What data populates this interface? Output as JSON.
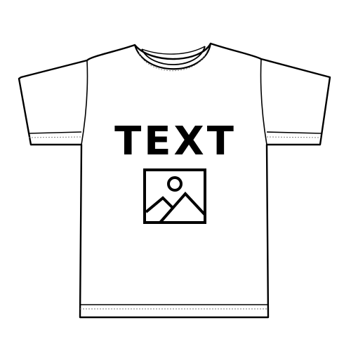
{
  "mockup": {
    "print_text": "TEXT",
    "image_placeholder_icon": "image-placeholder-icon",
    "colors": {
      "background": "#ffffff",
      "shirt_fill": "#ffffff",
      "outline": "#000000",
      "print": "#000000"
    }
  }
}
